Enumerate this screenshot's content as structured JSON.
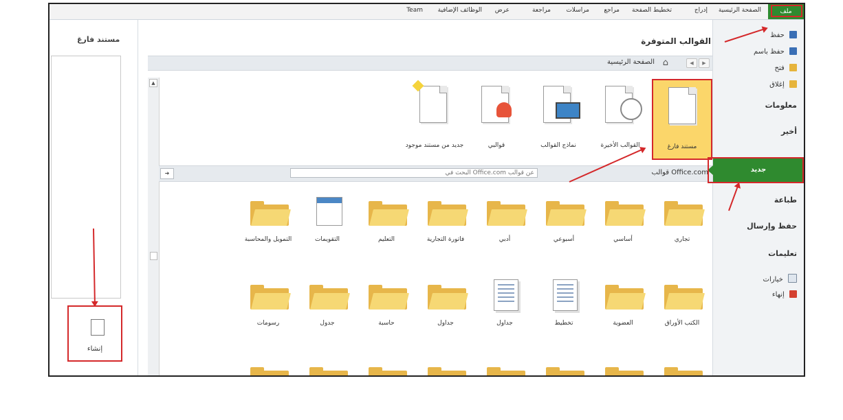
{
  "ribbon": {
    "file_tab": "ملف",
    "tabs": [
      "الصفحة الرئيسية",
      "إدراج",
      "تخطيط الصفحة",
      "مراجع",
      "مراسلات",
      "مراجعة",
      "عرض",
      "الوظائف الإضافية",
      "Team"
    ]
  },
  "sidebar": {
    "items": [
      {
        "label": "حفظ",
        "icon": "save-icon",
        "color": "#3a6fb5"
      },
      {
        "label": "حفظ باسم",
        "icon": "save-as-icon",
        "color": "#3a6fb5"
      },
      {
        "label": "فتح",
        "icon": "open-folder-icon",
        "color": "#e6b43c"
      },
      {
        "label": "إغلاق",
        "icon": "close-folder-icon",
        "color": "#e6b43c"
      }
    ],
    "info": "معلومات",
    "recent": "أخير",
    "new": "جديد",
    "print": "طباعة",
    "save_send": "حفظ وإرسال",
    "help": "تعليمات",
    "options": "خيارات",
    "exit": "إنهاء"
  },
  "main": {
    "title": "القوالب المتوفرة",
    "breadcrumb": "الصفحة الرئيسية",
    "templates": [
      {
        "label": "مستند فارغ",
        "selected": true
      },
      {
        "label": "القوالب الأخيرة"
      },
      {
        "label": "نماذج القوالب"
      },
      {
        "label": "قوالبي"
      },
      {
        "label": "جديد من مستند موجود"
      }
    ],
    "office_label": "قوالب Office.com",
    "search_placeholder": "البحث في Office.com عن قوالب",
    "folders_row1": [
      "تجاري",
      "أساسي",
      "أسبوعي",
      "أدبي",
      "فاتورة التجارية",
      "التعليم",
      "التقويمات",
      "التمويل والمحاسبة"
    ],
    "folders_row2": [
      "الكتب الأوراق",
      "العضوية",
      "تخطيط",
      "جداول",
      "جداول",
      "حاسبة",
      "جدول",
      "رسومات"
    ]
  },
  "preview": {
    "title": "مستند فارغ",
    "create_label": "إنشاء"
  },
  "colors": {
    "accent_green": "#2f8a2f",
    "highlight_red": "#d4282a",
    "selected_yellow": "#fbd66a"
  }
}
